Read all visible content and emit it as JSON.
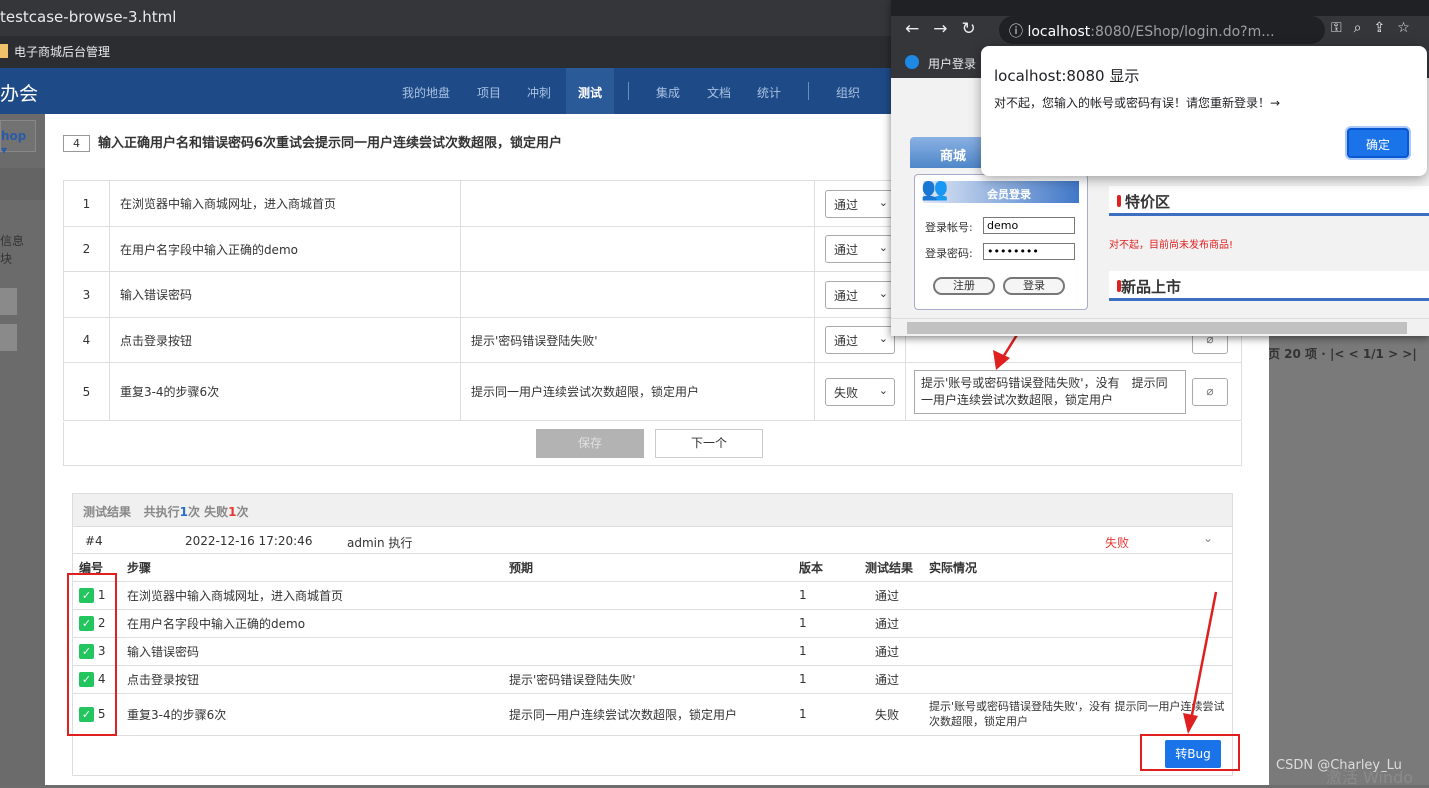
{
  "browser": {
    "tab_title": "testcase-browse-3.html",
    "bookmark": "电子商城后台管理"
  },
  "app": {
    "brand": "办会",
    "nav": [
      "我的地盘",
      "项目",
      "冲刺",
      "测试",
      "集成",
      "文档",
      "统计",
      "组织"
    ],
    "active_nav": "测试",
    "product_select": "hop"
  },
  "left_sidebar": {
    "text_lines": [
      "信息",
      "块"
    ]
  },
  "case": {
    "number": "4",
    "title": "输入正确用户名和错误密码6次重试会提示同一用户连续尝试次数超限，锁定用户"
  },
  "steps": [
    {
      "id": "1",
      "desc": "在浏览器中输入商城网址，进入商城首页",
      "expect": "",
      "result": "通过",
      "actual": ""
    },
    {
      "id": "2",
      "desc": "在用户名字段中输入正确的demo",
      "expect": "",
      "result": "通过",
      "actual": ""
    },
    {
      "id": "3",
      "desc": "输入错误密码",
      "expect": "",
      "result": "通过",
      "actual": ""
    },
    {
      "id": "4",
      "desc": "点击登录按钮",
      "expect": "提示'密码错误登陆失败'",
      "result": "通过",
      "actual": ""
    },
    {
      "id": "5",
      "desc": "重复3-4的步骤6次",
      "expect": "提示同一用户连续尝试次数超限，锁定用户",
      "result": "失败",
      "actual": "提示'账号或密码错误登陆失败'，没有　提示同一用户连续尝试次数超限，锁定用户"
    }
  ],
  "buttons": {
    "save": "保存",
    "next": "下一个",
    "to_bug": "转Bug"
  },
  "results": {
    "header_label": "测试结果",
    "header_prefix": "共执行",
    "header_count": "1",
    "header_mid": "次 失败",
    "header_fail": "1",
    "header_suffix": "次",
    "run": {
      "id": "#4",
      "time": "2022-12-16 17:20:46",
      "executor": "admin 执行",
      "status": "失败"
    },
    "columns": [
      "编号",
      "步骤",
      "预期",
      "版本",
      "测试结果",
      "实际情况"
    ],
    "rows": [
      {
        "no": "1",
        "step": "在浏览器中输入商城网址，进入商城首页",
        "expect": "",
        "version": "1",
        "result": "通过",
        "actual": ""
      },
      {
        "no": "2",
        "step": "在用户名字段中输入正确的demo",
        "expect": "",
        "version": "1",
        "result": "通过",
        "actual": ""
      },
      {
        "no": "3",
        "step": "输入错误密码",
        "expect": "",
        "version": "1",
        "result": "通过",
        "actual": ""
      },
      {
        "no": "4",
        "step": "点击登录按钮",
        "expect": "提示'密码错误登陆失败'",
        "version": "1",
        "result": "通过",
        "actual": ""
      },
      {
        "no": "5",
        "step": "重复3-4的步骤6次",
        "expect": "提示同一用户连续尝试次数超限，锁定用户",
        "version": "1",
        "result": "失败",
        "actual": "提示'账号或密码错误登陆失败'，没有 提示同一用户连续尝试次数超限，锁定用户"
      }
    ]
  },
  "pager": "页 20 项 · |< < 1/1 > >|",
  "popup": {
    "url_host": "localhost",
    "url_path": ":8080/EShop/login.do?m...",
    "bookmark": "用户登录",
    "shop_tab": "商城",
    "login": {
      "title": "会员登录",
      "account_label": "登录帐号:",
      "account_value": "demo",
      "password_label": "登录密码:",
      "password_value": "••••••••",
      "register": "注册",
      "login": "登录"
    },
    "specials": "特价区",
    "no_goods": "对不起，目前尚未发布商品!",
    "new_items": "新品上市"
  },
  "alert": {
    "title": "localhost:8080 显示",
    "message": "对不起，您输入的帐号或密码有误！请您重新登录！→",
    "ok": "确定"
  },
  "watermark": "CSDN @Charley_Lu",
  "watermark2": "激活 Windo",
  "colors": {
    "nav_bg": "#1e4b87",
    "accent": "#1a73e8",
    "fail": "#e53935",
    "pass_check": "#22c55e",
    "annotation": "#e02020"
  }
}
